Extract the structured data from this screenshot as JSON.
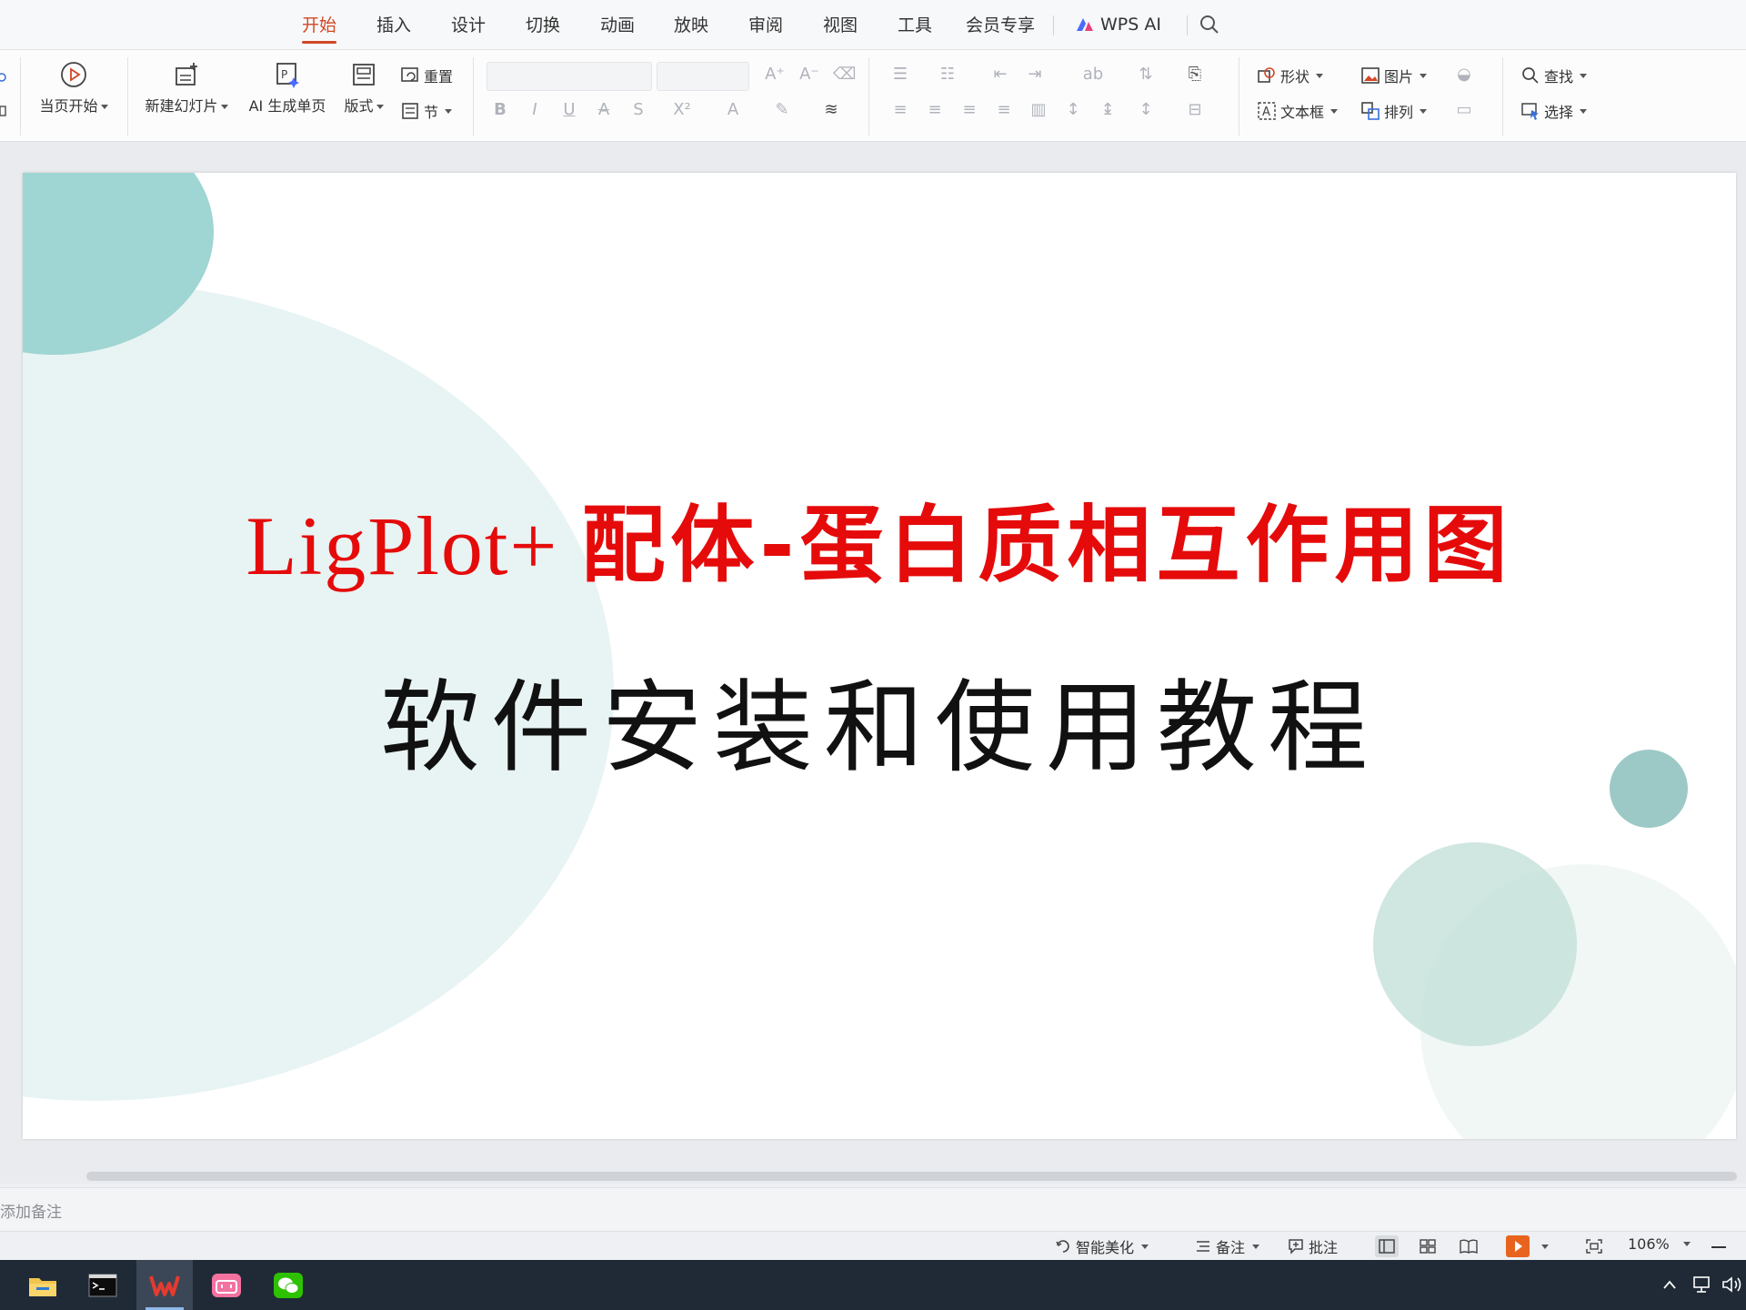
{
  "menu": {
    "tabs": [
      "开始",
      "插入",
      "设计",
      "切换",
      "动画",
      "放映",
      "审阅",
      "视图",
      "工具",
      "会员专享"
    ],
    "active_tab": "开始",
    "ai_label": "WPS AI"
  },
  "ribbon": {
    "play_from_current": "当页开始",
    "new_slide": "新建幻灯片",
    "ai_generate_page": "AI 生成单页",
    "layout": "版式",
    "reset": "重置",
    "section": "节",
    "shape": "形状",
    "picture": "图片",
    "textbox": "文本框",
    "arrange": "排列",
    "find": "查找",
    "select": "选择"
  },
  "slide": {
    "title_latin": "LigPlot+ ",
    "title_cjk": "配体-蛋白质相互作用图",
    "subtitle": "软件安装和使用教程",
    "colors": {
      "title": "#e50b0b",
      "subtitle": "#111111",
      "circle_teal": "#9fd5d3",
      "circle_light": "#e7f3f2"
    }
  },
  "notes": {
    "placeholder": "添加备注"
  },
  "status": {
    "smart_beautify": "智能美化",
    "notes_btn": "备注",
    "comment_btn": "批注",
    "zoom": "106%"
  }
}
